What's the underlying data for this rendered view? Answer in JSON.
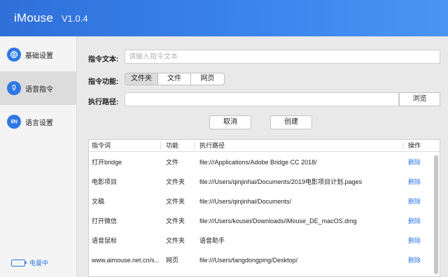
{
  "header": {
    "title": "iMouse",
    "version": "V1.0.4"
  },
  "sidebar": {
    "items": [
      {
        "label": "基础设置",
        "icon": "gear-icon"
      },
      {
        "label": "语音指令",
        "icon": "microphone-icon"
      },
      {
        "label": "语言设置",
        "icon": "language-icon",
        "icon_text": "EN"
      }
    ],
    "active_index": 1,
    "battery": {
      "label": "电量中",
      "level": 0.85
    }
  },
  "form": {
    "text_label": "指令文本:",
    "text_placeholder": "请输入指令文本",
    "text_value": "",
    "function_label": "指令功能:",
    "function_options": [
      "文件夹",
      "文件",
      "网页"
    ],
    "function_selected": 0,
    "path_label": "执行路径:",
    "path_value": "",
    "browse_label": "浏览"
  },
  "actions": {
    "cancel_label": "取消",
    "create_label": "创建"
  },
  "table": {
    "columns": [
      "指令词",
      "功能",
      "执行路径",
      "操作"
    ],
    "rows": [
      {
        "word": "打开bridge",
        "func": "文件",
        "path": "file:///Applications/Adobe Bridge CC 2018/",
        "op": "删除"
      },
      {
        "word": "电影项目",
        "func": "文件夹",
        "path": "file:///Users/qinjinhai/Documents/2019电影项目计划.pages",
        "op": "删除"
      },
      {
        "word": "文稿",
        "func": "文件夹",
        "path": "file:///Users/qinjinhai/Documents/",
        "op": "删除"
      },
      {
        "word": "打开微信",
        "func": "文件夹",
        "path": "file:///Users/kousei/Downloads/iMouse_DE_macOS.dmg",
        "op": "删除"
      },
      {
        "word": "语音鼠标",
        "func": "文件夹",
        "path": "语音助手",
        "op": "删除"
      },
      {
        "word": "www.aimouse.net.cn/s...",
        "func": "网页",
        "path": "file:///Users/tangdongping/Desktop/",
        "op": "删除"
      }
    ]
  },
  "colors": {
    "accent": "#2f78e4",
    "header_start": "#2f6fd8",
    "header_end": "#4a95f2"
  }
}
